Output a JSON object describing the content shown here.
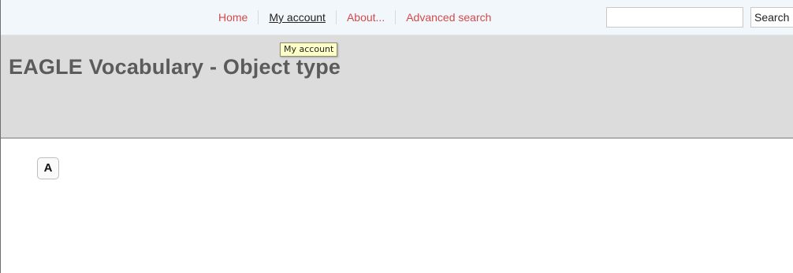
{
  "nav": {
    "items": [
      {
        "label": "Home"
      },
      {
        "label": "My account"
      },
      {
        "label": "About..."
      },
      {
        "label": "Advanced search"
      }
    ]
  },
  "search": {
    "value": "",
    "button_label": "Search"
  },
  "tooltip": {
    "text": "My account"
  },
  "header": {
    "title": "EAGLE Vocabulary - Object type"
  },
  "alphabet": {
    "letters": [
      "A"
    ]
  }
}
